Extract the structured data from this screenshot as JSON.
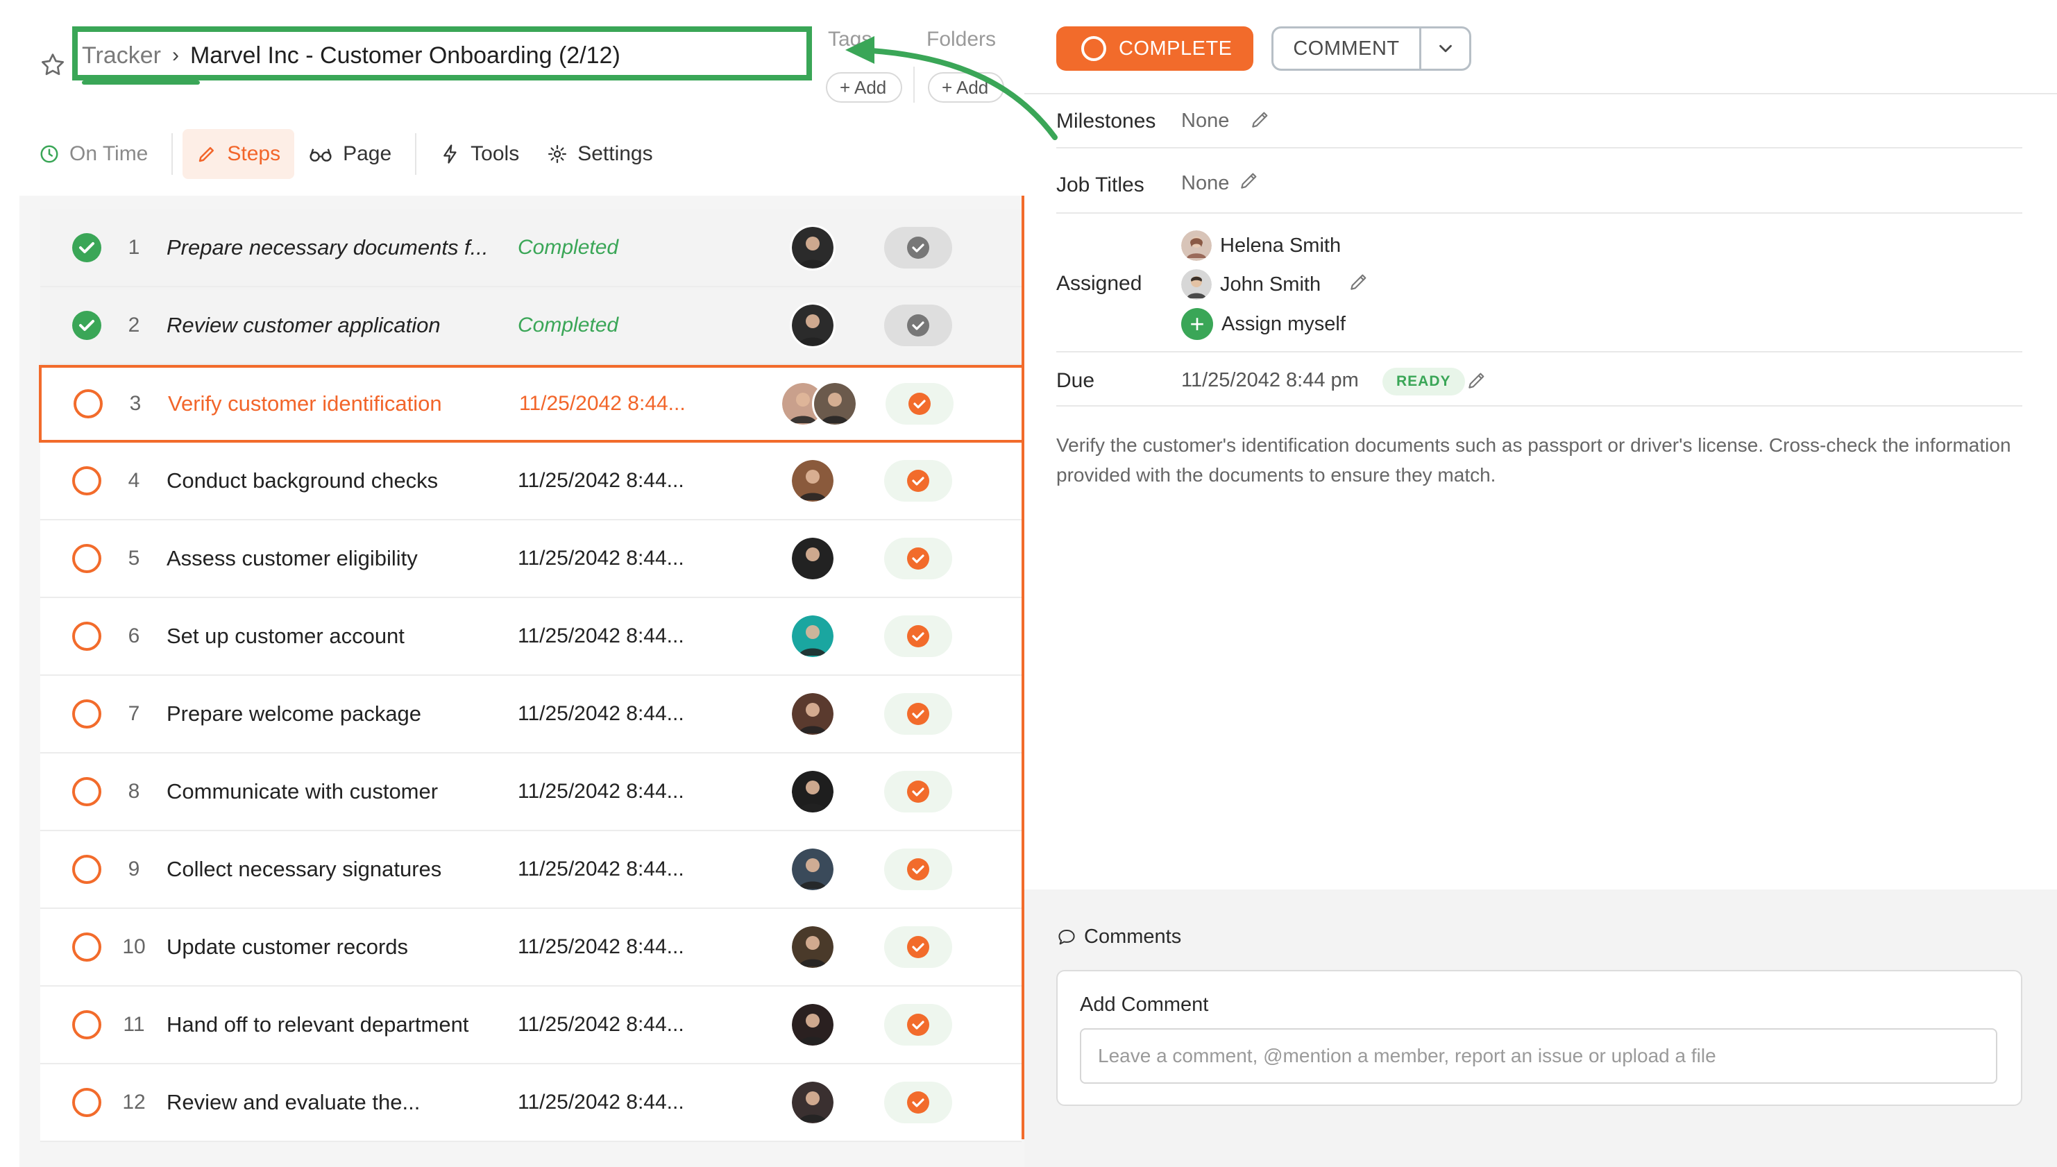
{
  "header": {
    "breadcrumb_root": "Tracker",
    "breadcrumb_sep": "›",
    "page_title": "Marvel Inc - Customer Onboarding (2/12)",
    "tags_label": "Tags",
    "folders_label": "Folders",
    "tags_add": "+ Add",
    "folders_add": "+ Add"
  },
  "tabs": {
    "on_time": "On Time",
    "steps": "Steps",
    "page": "Page",
    "tools": "Tools",
    "settings": "Settings"
  },
  "steps": [
    {
      "num": "1",
      "name": "Prepare necessary documents f...",
      "due": "Completed",
      "state": "done",
      "avatars": [
        "#2b2b2b"
      ]
    },
    {
      "num": "2",
      "name": "Review customer application",
      "due": "Completed",
      "state": "done",
      "avatars": [
        "#2b2b2b"
      ]
    },
    {
      "num": "3",
      "name": "Verify customer identification",
      "due": "11/25/2042 8:44...",
      "state": "active",
      "avatars": [
        "#c9a08c",
        "#6b5a4c"
      ]
    },
    {
      "num": "4",
      "name": "Conduct background checks",
      "due": "11/25/2042 8:44...",
      "state": "open",
      "avatars": [
        "#8a5a3c"
      ]
    },
    {
      "num": "5",
      "name": "Assess customer eligibility",
      "due": "11/25/2042 8:44...",
      "state": "open",
      "avatars": [
        "#222222"
      ]
    },
    {
      "num": "6",
      "name": "Set up customer account",
      "due": "11/25/2042 8:44...",
      "state": "open",
      "avatars": [
        "#1aa6a0"
      ]
    },
    {
      "num": "7",
      "name": "Prepare welcome package",
      "due": "11/25/2042 8:44...",
      "state": "open",
      "avatars": [
        "#5a3a2e"
      ]
    },
    {
      "num": "8",
      "name": "Communicate with customer",
      "due": "11/25/2042 8:44...",
      "state": "open",
      "avatars": [
        "#1e1e1e"
      ]
    },
    {
      "num": "9",
      "name": "Collect necessary signatures",
      "due": "11/25/2042 8:44...",
      "state": "open",
      "avatars": [
        "#3a4a5a"
      ]
    },
    {
      "num": "10",
      "name": "Update customer records",
      "due": "11/25/2042 8:44...",
      "state": "open",
      "avatars": [
        "#4a3a2a"
      ]
    },
    {
      "num": "11",
      "name": "Hand off to relevant department",
      "due": "11/25/2042 8:44...",
      "state": "open",
      "avatars": [
        "#2a2020"
      ]
    },
    {
      "num": "12",
      "name": "Review and evaluate the...",
      "due": "11/25/2042 8:44...",
      "state": "open",
      "avatars": [
        "#3a3030"
      ]
    }
  ],
  "actions": {
    "complete": "COMPLETE",
    "comment": "COMMENT"
  },
  "details": {
    "milestones_label": "Milestones",
    "milestones_value": "None",
    "job_titles_label": "Job Titles",
    "job_titles_value": "None",
    "assigned_label": "Assigned",
    "assignees": [
      "Helena Smith",
      "John Smith"
    ],
    "assign_myself": "Assign myself",
    "due_label": "Due",
    "due_value": "11/25/2042 8:44 pm",
    "due_badge": "READY",
    "description": "Verify the customer's identification documents such as passport or driver's license. Cross-check the information provided with the documents to ensure they match."
  },
  "comments": {
    "heading": "Comments",
    "card_title": "Add Comment",
    "placeholder": "Leave a comment, @mention a member, report an issue or upload a file"
  },
  "colors": {
    "accent": "#f26b2b",
    "success": "#3aa657",
    "highlight_box": "#3aa657"
  }
}
